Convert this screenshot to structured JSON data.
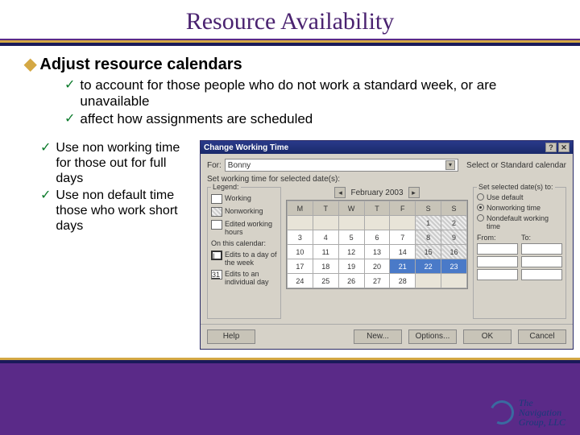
{
  "title": "Resource Availability",
  "main_bullet": {
    "symbol": "◆",
    "text": "Adjust resource calendars"
  },
  "sub_bullets_top": [
    "to account for those people who do not work a standard week, or are unavailable",
    "affect how assignments are scheduled"
  ],
  "sub_bullets_left": [
    "Use non working time for those out for full days",
    "Use non default time those who work short days"
  ],
  "dialog": {
    "title": "Change Working Time",
    "for_label": "For:",
    "for_value": "Bonny",
    "select_base_label": "Select or Standard calendar",
    "set_label": "Set working time for selected date(s):",
    "legend_title": "Legend:",
    "legend_items": [
      "Working",
      "Nonworking",
      "Edited working hours",
      "On this calendar:",
      "Edits to a day of the week",
      "Edits to an individual day"
    ],
    "month_label": "February 2003",
    "day_headers": [
      "M",
      "T",
      "W",
      "T",
      "F",
      "S",
      "S"
    ],
    "weeks": [
      [
        "",
        "",
        "",
        "",
        "",
        "1",
        "2"
      ],
      [
        "3",
        "4",
        "5",
        "6",
        "7",
        "8",
        "9"
      ],
      [
        "10",
        "11",
        "12",
        "13",
        "14",
        "15",
        "16"
      ],
      [
        "17",
        "18",
        "19",
        "20",
        "21",
        "22",
        "23"
      ],
      [
        "24",
        "25",
        "26",
        "27",
        "28",
        "",
        ""
      ]
    ],
    "selected_cells": [
      "21",
      "22",
      "23"
    ],
    "opts_title": "Set selected date(s) to:",
    "radio_options": [
      "Use default",
      "Nonworking time",
      "Nondefault working time"
    ],
    "radio_selected": 1,
    "from_label": "From:",
    "to_label": "To:",
    "buttons": {
      "help": "Help",
      "new": "New...",
      "options": "Options...",
      "ok": "OK",
      "cancel": "Cancel"
    }
  },
  "logo": {
    "line1": "The",
    "line2": "Navigation",
    "line3": "Group, LLC"
  }
}
